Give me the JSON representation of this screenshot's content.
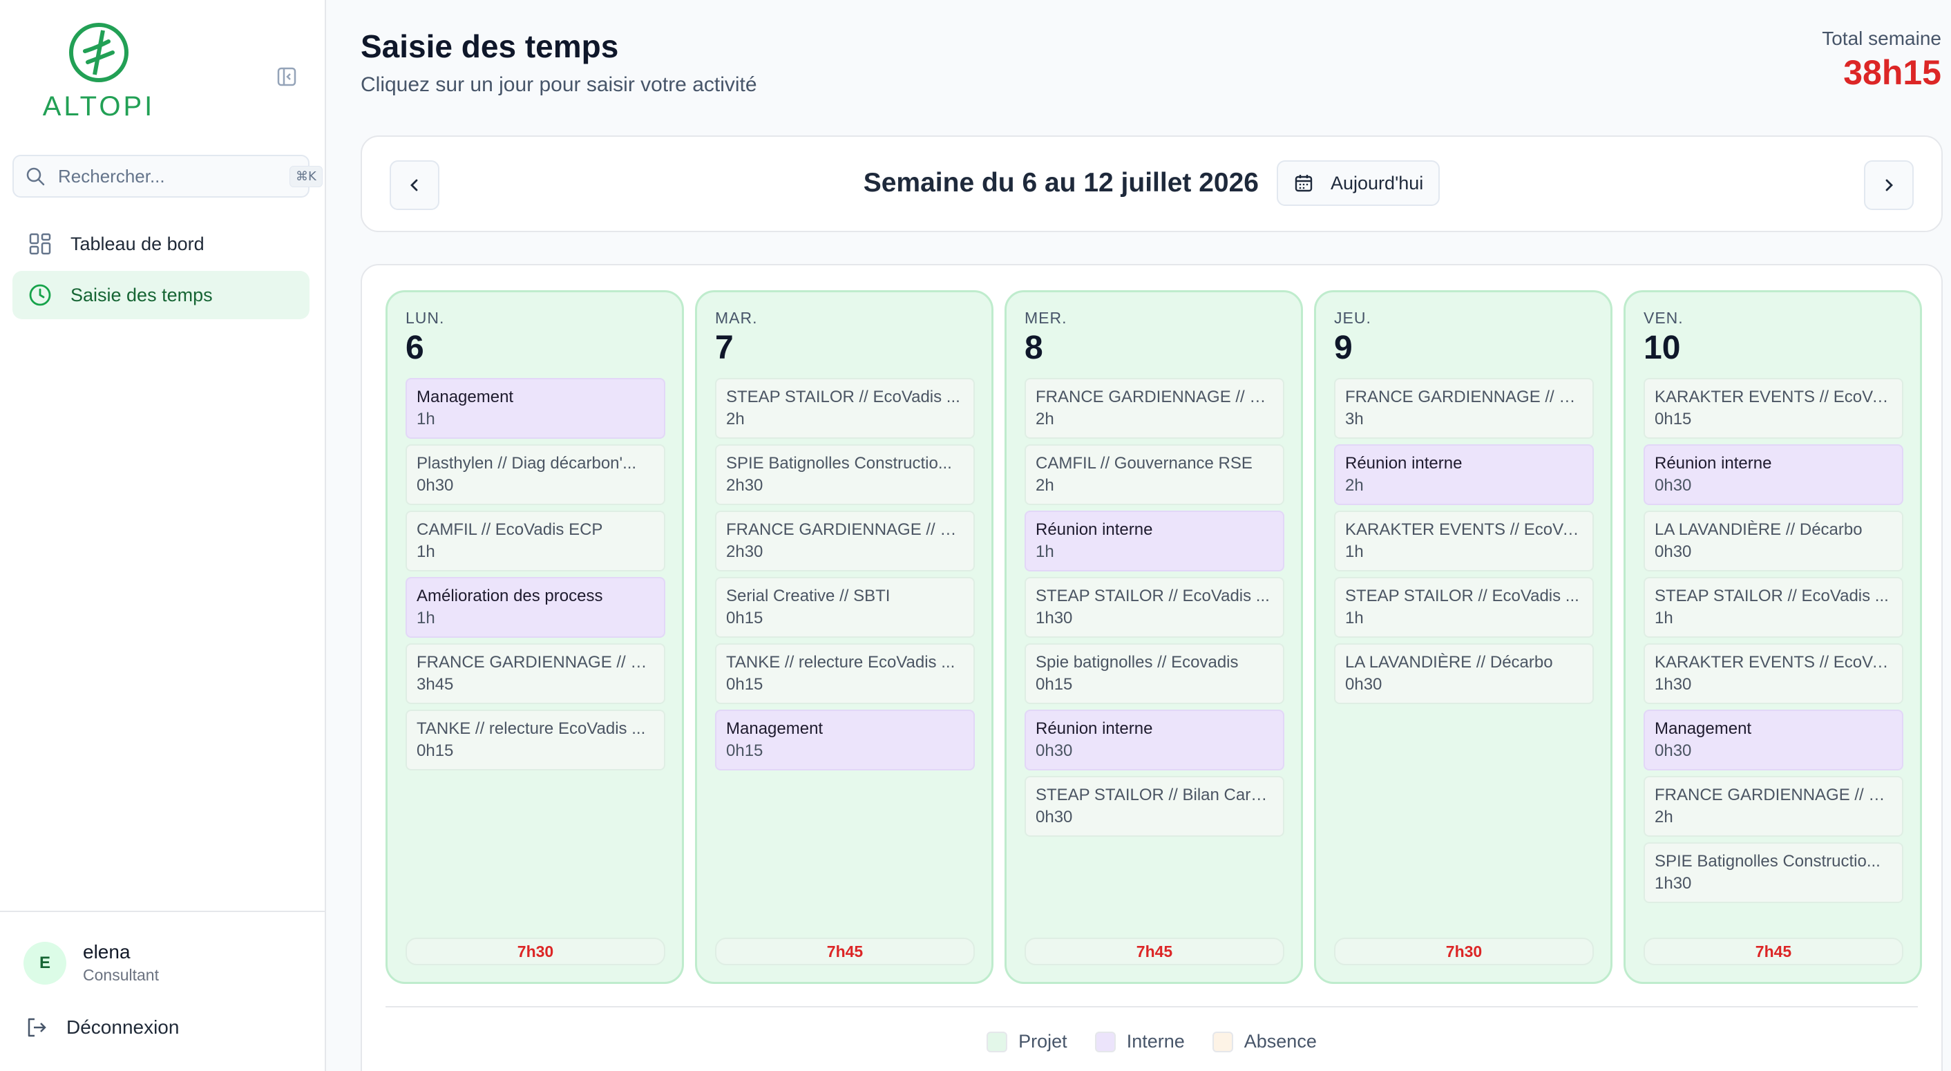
{
  "sidebar": {
    "brand": "ALTOPI",
    "search": {
      "placeholder": "Rechercher...",
      "shortcut": "⌘K"
    },
    "nav": [
      {
        "label": "Tableau de bord",
        "icon": "dashboard-icon",
        "active": false
      },
      {
        "label": "Saisie des temps",
        "icon": "clock-icon",
        "active": true
      }
    ],
    "user": {
      "initial": "E",
      "name": "elena",
      "role": "Consultant"
    },
    "logout_label": "Déconnexion"
  },
  "header": {
    "title": "Saisie des temps",
    "subtitle": "Cliquez sur un jour pour saisir votre activité",
    "total_label": "Total semaine",
    "total_value": "38h15"
  },
  "week": {
    "label": "Semaine du 6 au 12 juillet 2026",
    "today_label": "Aujourd'hui"
  },
  "days": [
    {
      "name": "LUN.",
      "num": "6",
      "total": "7h30",
      "entries": [
        {
          "title": "Management",
          "duration": "1h",
          "type": "interne"
        },
        {
          "title": "Plasthylen // Diag décarbon'...",
          "duration": "0h30",
          "type": "projet"
        },
        {
          "title": "CAMFIL // EcoVadis ECP",
          "duration": "1h",
          "type": "projet"
        },
        {
          "title": "Amélioration des process",
          "duration": "1h",
          "type": "interne"
        },
        {
          "title": "FRANCE GARDIENNAGE // R...",
          "duration": "3h45",
          "type": "projet"
        },
        {
          "title": "TANKE // relecture EcoVadis ...",
          "duration": "0h15",
          "type": "projet"
        }
      ]
    },
    {
      "name": "MAR.",
      "num": "7",
      "total": "7h45",
      "entries": [
        {
          "title": "STEAP STAILOR // EcoVadis ...",
          "duration": "2h",
          "type": "projet"
        },
        {
          "title": "SPIE Batignolles Constructio...",
          "duration": "2h30",
          "type": "projet"
        },
        {
          "title": "FRANCE GARDIENNAGE // R...",
          "duration": "2h30",
          "type": "projet"
        },
        {
          "title": "Serial Creative // SBTI",
          "duration": "0h15",
          "type": "projet"
        },
        {
          "title": "TANKE // relecture EcoVadis ...",
          "duration": "0h15",
          "type": "projet"
        },
        {
          "title": "Management",
          "duration": "0h15",
          "type": "interne"
        }
      ]
    },
    {
      "name": "MER.",
      "num": "8",
      "total": "7h45",
      "entries": [
        {
          "title": "FRANCE GARDIENNAGE // R...",
          "duration": "2h",
          "type": "projet"
        },
        {
          "title": "CAMFIL // Gouvernance RSE",
          "duration": "2h",
          "type": "projet"
        },
        {
          "title": "Réunion interne",
          "duration": "1h",
          "type": "interne"
        },
        {
          "title": "STEAP STAILOR // EcoVadis ...",
          "duration": "1h30",
          "type": "projet"
        },
        {
          "title": "Spie batignolles // Ecovadis",
          "duration": "0h15",
          "type": "projet"
        },
        {
          "title": "Réunion interne",
          "duration": "0h30",
          "type": "interne"
        },
        {
          "title": "STEAP STAILOR // Bilan Carb...",
          "duration": "0h30",
          "type": "projet"
        }
      ]
    },
    {
      "name": "JEU.",
      "num": "9",
      "total": "7h30",
      "entries": [
        {
          "title": "FRANCE GARDIENNAGE // R...",
          "duration": "3h",
          "type": "projet"
        },
        {
          "title": "Réunion interne",
          "duration": "2h",
          "type": "interne"
        },
        {
          "title": "KARAKTER EVENTS // EcoVa...",
          "duration": "1h",
          "type": "projet"
        },
        {
          "title": "STEAP STAILOR // EcoVadis ...",
          "duration": "1h",
          "type": "projet"
        },
        {
          "title": "LA LAVANDIÈRE // Décarbo",
          "duration": "0h30",
          "type": "projet"
        }
      ]
    },
    {
      "name": "VEN.",
      "num": "10",
      "total": "7h45",
      "entries": [
        {
          "title": "KARAKTER EVENTS // EcoVa...",
          "duration": "0h15",
          "type": "projet"
        },
        {
          "title": "Réunion interne",
          "duration": "0h30",
          "type": "interne"
        },
        {
          "title": "LA LAVANDIÈRE // Décarbo",
          "duration": "0h30",
          "type": "projet"
        },
        {
          "title": "STEAP STAILOR // EcoVadis ...",
          "duration": "1h",
          "type": "projet"
        },
        {
          "title": "KARAKTER EVENTS // EcoVa...",
          "duration": "1h30",
          "type": "projet"
        },
        {
          "title": "Management",
          "duration": "0h30",
          "type": "interne"
        },
        {
          "title": "FRANCE GARDIENNAGE // R...",
          "duration": "2h",
          "type": "projet"
        },
        {
          "title": "SPIE Batignolles Constructio...",
          "duration": "1h30",
          "type": "projet"
        }
      ]
    }
  ],
  "legend": [
    {
      "label": "Projet",
      "color": "#e3f7e9"
    },
    {
      "label": "Interne",
      "color": "#ece4fb"
    },
    {
      "label": "Absence",
      "color": "#fdf3e6"
    }
  ],
  "colors": {
    "brand": "#22a055",
    "accent_red": "#dc2626",
    "day_bg": "#e6f9ec"
  }
}
